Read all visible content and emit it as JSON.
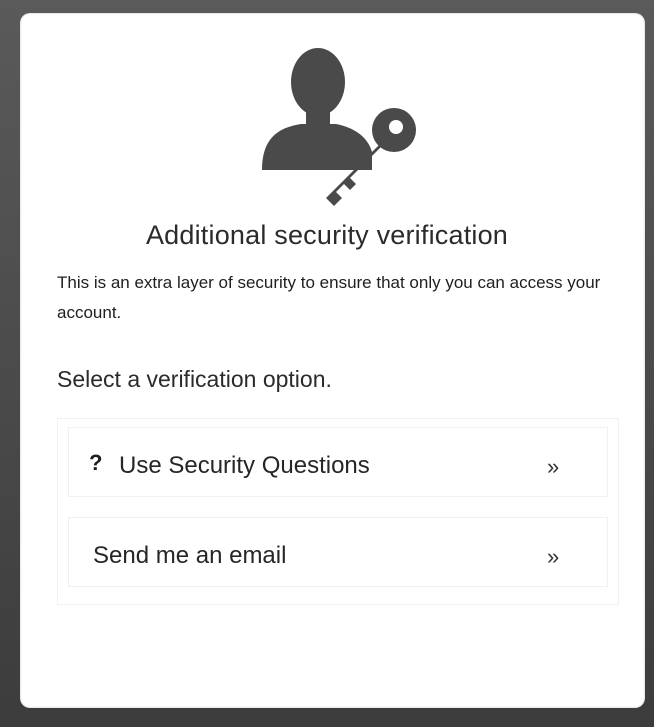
{
  "dialog": {
    "title": "Additional security verification",
    "subtitle": "This is an extra layer of security to ensure that only you can access your account.",
    "prompt": "Select a verification option.",
    "hero_icon": "user-key-icon"
  },
  "options": [
    {
      "label": "Use Security Questions",
      "prefix": "?",
      "chevron": "»",
      "icon": "question-mark-icon"
    },
    {
      "label": "Send me an email",
      "chevron": "»"
    }
  ],
  "colors": {
    "background": "#4a4a4a",
    "card": "#ffffff",
    "icon": "#4a4a4a",
    "text": "#2b2b2b"
  }
}
